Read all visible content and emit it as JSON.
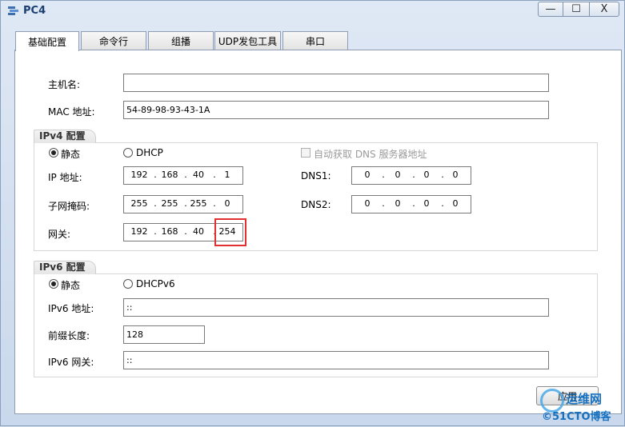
{
  "window": {
    "title": "PC4",
    "min_glyph": "—",
    "max_glyph": "☐",
    "close_glyph": "X"
  },
  "tabs": [
    {
      "label": "基础配置",
      "active": true
    },
    {
      "label": "命令行"
    },
    {
      "label": "组播"
    },
    {
      "label": "UDP发包工具"
    },
    {
      "label": "串口"
    }
  ],
  "basic": {
    "hostname_label": "主机名:",
    "hostname_value": "",
    "mac_label": "MAC 地址:",
    "mac_value": "54-89-98-93-43-1A"
  },
  "ipv4": {
    "title": "IPv4 配置",
    "static_label": "静态",
    "dhcp_label": "DHCP",
    "mode": "static",
    "auto_dns_label": "自动获取 DNS 服务器地址",
    "ip_label": "IP 地址:",
    "ip": [
      "192",
      "168",
      "40",
      "1"
    ],
    "mask_label": "子网掩码:",
    "mask": [
      "255",
      "255",
      "255",
      "0"
    ],
    "gateway_label": "网关:",
    "gateway": [
      "192",
      "168",
      "40",
      "254"
    ],
    "dns1_label": "DNS1:",
    "dns1": [
      "0",
      "0",
      "0",
      "0"
    ],
    "dns2_label": "DNS2:",
    "dns2": [
      "0",
      "0",
      "0",
      "0"
    ]
  },
  "ipv6": {
    "title": "IPv6 配置",
    "static_label": "静态",
    "dhcp_label": "DHCPv6",
    "mode": "static",
    "addr_label": "IPv6 地址:",
    "addr_value": "::",
    "prefix_label": "前缀长度:",
    "prefix_value": "128",
    "gateway_label": "IPv6 网关:",
    "gateway_value": "::"
  },
  "apply_label": "应用",
  "watermark": {
    "line1": "运维网",
    "line2": "©51CTO博客"
  },
  "colors": {
    "highlight": "#e03030",
    "title": "#1a3e72"
  }
}
